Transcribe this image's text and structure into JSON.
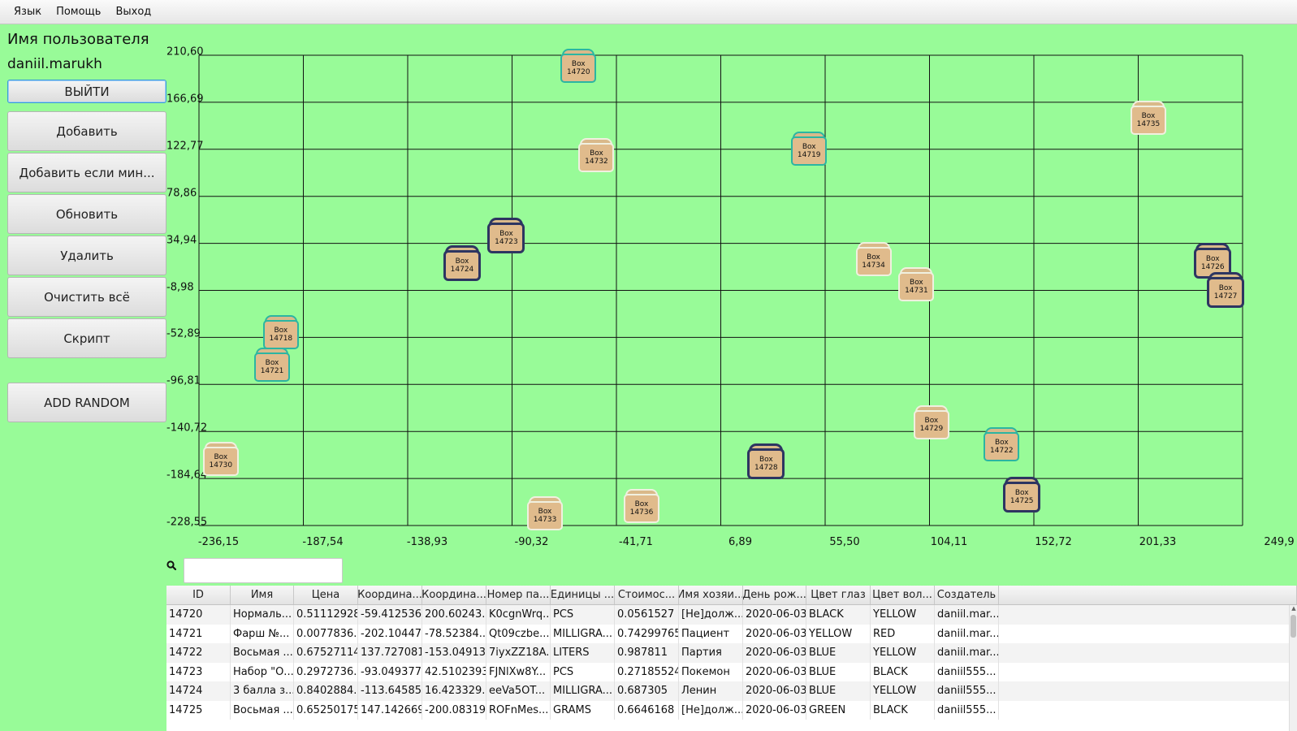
{
  "menu": {
    "items": [
      "Язык",
      "Помощь",
      "Выход"
    ]
  },
  "user": {
    "label": "Имя пользователя",
    "name": "daniil.marukh"
  },
  "buttons": {
    "logout": "ВЫЙТИ",
    "add": "Добавить",
    "add_if_min": "Добавить если мин...",
    "update": "Обновить",
    "remove": "Удалить",
    "clear": "Очистить всё",
    "script": "Скрипт",
    "add_random": "ADD RANDOM"
  },
  "chart_data": {
    "type": "scatter",
    "xlim": [
      -236.15,
      249.9
    ],
    "ylim": [
      -228.55,
      210.6
    ],
    "x_ticks": [
      "-236,15",
      "-187,54",
      "-138,93",
      "-90,32",
      "-41,71",
      "6,89",
      "55,50",
      "104,11",
      "152,72",
      "201,33",
      "249,9"
    ],
    "y_ticks": [
      "210,60",
      "166,69",
      "122,77",
      "78,86",
      "34,94",
      "-8,98",
      "-52,89",
      "-96,81",
      "-140,72",
      "-184,64",
      "-228,55"
    ],
    "grid": true,
    "points": [
      {
        "id": "14720",
        "label": "Box",
        "x": -59.4,
        "y": 200.6,
        "style": "teal"
      },
      {
        "id": "14735",
        "label": "Box",
        "x": 206.0,
        "y": 152.0,
        "style": "plain"
      },
      {
        "id": "14719",
        "label": "Box",
        "x": 48.0,
        "y": 123.0,
        "style": "teal"
      },
      {
        "id": "14732",
        "label": "Box",
        "x": -51.0,
        "y": 117.0,
        "style": "plain"
      },
      {
        "id": "14723",
        "label": "Box",
        "x": -93.0,
        "y": 42.5,
        "style": "navy"
      },
      {
        "id": "14724",
        "label": "Box",
        "x": -113.6,
        "y": 16.4,
        "style": "navy"
      },
      {
        "id": "14734",
        "label": "Box",
        "x": 78.0,
        "y": 20.0,
        "style": "plain"
      },
      {
        "id": "14731",
        "label": "Box",
        "x": 98.0,
        "y": -3.0,
        "style": "plain"
      },
      {
        "id": "14726",
        "label": "Box",
        "x": 236.0,
        "y": 19.0,
        "style": "navy"
      },
      {
        "id": "14727",
        "label": "Box",
        "x": 242.0,
        "y": -8.5,
        "style": "navy"
      },
      {
        "id": "14718",
        "label": "Box",
        "x": -198.0,
        "y": -48.0,
        "style": "teal"
      },
      {
        "id": "14721",
        "label": "Box",
        "x": -202.1,
        "y": -78.5,
        "style": "teal"
      },
      {
        "id": "14729",
        "label": "Box",
        "x": 105.0,
        "y": -132.0,
        "style": "plain"
      },
      {
        "id": "14722",
        "label": "Box",
        "x": 137.7,
        "y": -153.0,
        "style": "teal"
      },
      {
        "id": "14728",
        "label": "Box",
        "x": 28.0,
        "y": -169.0,
        "style": "navy"
      },
      {
        "id": "14725",
        "label": "Box",
        "x": 147.1,
        "y": -200.1,
        "style": "navy"
      },
      {
        "id": "14730",
        "label": "Box",
        "x": -226.0,
        "y": -166.0,
        "style": "plain"
      },
      {
        "id": "14733",
        "label": "Box",
        "x": -75.0,
        "y": -217.0,
        "style": "plain"
      },
      {
        "id": "14736",
        "label": "Box",
        "x": -30.0,
        "y": -210.0,
        "style": "plain"
      }
    ]
  },
  "search": {
    "placeholder": "",
    "value": ""
  },
  "table": {
    "columns": [
      "ID",
      "Имя",
      "Цена",
      "Координа...",
      "Координа...",
      "Номер па...",
      "Единицы ...",
      "Стоимос...",
      "Имя хозяи...",
      "День рож...",
      "Цвет глаз",
      "Цвет вол...",
      "Создатель"
    ],
    "rows": [
      [
        "14720",
        "Нормаль...",
        "0.51112928...",
        "-59.412536...",
        "200.60243...",
        "K0cgnWrq...",
        "PCS",
        "0.0561527",
        "[Не]долж...",
        "2020-06-03",
        "BLACK",
        "YELLOW",
        "daniil.mar..."
      ],
      [
        "14721",
        "Фарш №...",
        "0.0077836...",
        "-202.10447...",
        "-78.52384...",
        "Qt09czbe...",
        "MILLIGRA...",
        "0.74299765",
        "Пациент",
        "2020-06-03",
        "YELLOW",
        "RED",
        "daniil.mar..."
      ],
      [
        "14722",
        "Восьмая ...",
        "0.67527114...",
        "137.727081...",
        "-153.04913...",
        "7iyxZZ18A...",
        "LITERS",
        "0.987811",
        "Партия",
        "2020-06-03",
        "BLUE",
        "YELLOW",
        "daniil.mar..."
      ],
      [
        "14723",
        "Набор \"О...",
        "0.2972736...",
        "-93.049377...",
        "42.5102393...",
        "FJNlXw8Y...",
        "PCS",
        "0.27185524",
        "Покемон",
        "2020-06-03",
        "BLUE",
        "BLACK",
        "daniil555..."
      ],
      [
        "14724",
        "3 балла з...",
        "0.8402884...",
        "-113.64585...",
        "16.423329...",
        "eeVa5OT...",
        "MILLIGRA...",
        "0.687305",
        "Ленин",
        "2020-06-03",
        "BLUE",
        "YELLOW",
        "daniil555..."
      ],
      [
        "14725",
        "Восьмая ...",
        "0.65250175...",
        "147.142669...",
        "-200.08319...",
        "ROFnMes...",
        "GRAMS",
        "0.6646168",
        "[Не]долж...",
        "2020-06-03",
        "GREEN",
        "BLACK",
        "daniil555..."
      ]
    ]
  }
}
